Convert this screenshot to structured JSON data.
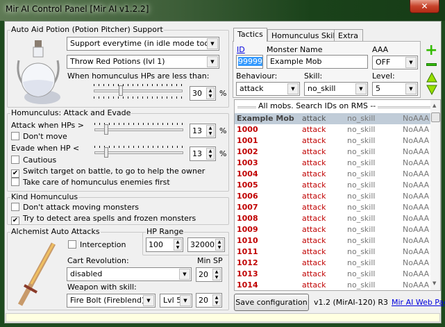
{
  "window": {
    "title": "Mir AI Control Panel [Mir AI v1.2.2]",
    "close": "✕"
  },
  "potion": {
    "group": "Auto Aid Potion (Potion Pitcher) Support",
    "mode": "Support everytime (in idle mode too)",
    "potion": "Throw Red Potions (lvl 1)",
    "hp_label": "When homunculus HPs are less than:",
    "hp_value": "30",
    "hp_percent": 30,
    "unit": "%"
  },
  "attack": {
    "group": "Homunculus: Attack and Evade",
    "attack_label": "Attack when HPs >",
    "attack_value": "13",
    "attack_percent": 13,
    "dont_move": "Don't move",
    "evade_label": "Evade when HP <",
    "evade_value": "13",
    "evade_percent": 13,
    "cautious": "Cautious",
    "switch_target": "Switch target on battle, to go to help the owner",
    "take_care": "Take care of homunculus enemies first",
    "unit": "%"
  },
  "kind": {
    "group": "Kind Homunculus",
    "dont_attack": "Don't attack moving monsters",
    "detect": "Try to detect area spells and frozen monsters"
  },
  "alch": {
    "group": "Alchemist Auto Attacks",
    "interception": "Interception",
    "hp_range": "HP Range",
    "hp_min": "100",
    "hp_max": "32000",
    "cart_label": "Cart Revolution:",
    "cart_value": "disabled",
    "min_sp": "Min SP",
    "cart_sp": "20",
    "weapon_label": "Weapon with skill:",
    "weapon_value": "Fire Bolt (Fireblend)",
    "weapon_lvl": "Lvl 5",
    "weapon_sp": "20"
  },
  "tabs": [
    "Tactics",
    "Homunculus Skills",
    "Extra"
  ],
  "tactics": {
    "id_label": "ID",
    "id_value": "99999",
    "name_label": "Monster Name",
    "name_value": "Example Mob",
    "aaa_label": "AAA",
    "aaa_value": "OFF",
    "behaviour_label": "Behaviour:",
    "behaviour_value": "attack",
    "skill_label": "Skill:",
    "skill_value": "no_skill",
    "level_label": "Level:",
    "level_value": "5"
  },
  "list": {
    "header": "All mobs. Search IDs on RMS --",
    "rows": [
      {
        "name": "Example Mob",
        "behaviour": "attack",
        "skill": "no_skill",
        "aaa": "NoAAA"
      },
      {
        "name": "1000",
        "behaviour": "attack",
        "skill": "no_skill",
        "aaa": "NoAAA"
      },
      {
        "name": "1001",
        "behaviour": "attack",
        "skill": "no_skill",
        "aaa": "NoAAA"
      },
      {
        "name": "1002",
        "behaviour": "attack",
        "skill": "no_skill",
        "aaa": "NoAAA"
      },
      {
        "name": "1003",
        "behaviour": "attack",
        "skill": "no_skill",
        "aaa": "NoAAA"
      },
      {
        "name": "1004",
        "behaviour": "attack",
        "skill": "no_skill",
        "aaa": "NoAAA"
      },
      {
        "name": "1005",
        "behaviour": "attack",
        "skill": "no_skill",
        "aaa": "NoAAA"
      },
      {
        "name": "1006",
        "behaviour": "attack",
        "skill": "no_skill",
        "aaa": "NoAAA"
      },
      {
        "name": "1007",
        "behaviour": "attack",
        "skill": "no_skill",
        "aaa": "NoAAA"
      },
      {
        "name": "1008",
        "behaviour": "attack",
        "skill": "no_skill",
        "aaa": "NoAAA"
      },
      {
        "name": "1009",
        "behaviour": "attack",
        "skill": "no_skill",
        "aaa": "NoAAA"
      },
      {
        "name": "1010",
        "behaviour": "attack",
        "skill": "no_skill",
        "aaa": "NoAAA"
      },
      {
        "name": "1011",
        "behaviour": "attack",
        "skill": "no_skill",
        "aaa": "NoAAA"
      },
      {
        "name": "1012",
        "behaviour": "attack",
        "skill": "no_skill",
        "aaa": "NoAAA"
      },
      {
        "name": "1013",
        "behaviour": "attack",
        "skill": "no_skill",
        "aaa": "NoAAA"
      },
      {
        "name": "1014",
        "behaviour": "attack",
        "skill": "no_skill",
        "aaa": "NoAAA"
      }
    ]
  },
  "footer": {
    "save": "Save configuration",
    "version": "v1.2 (MirAI-120) R3",
    "link": "Mir AI Web Page"
  },
  "colors": {
    "accent_red": "#c00000",
    "selected_row": "#c0ccd8",
    "status_bar": "#ffffe1",
    "icon_green": "#33bb00"
  },
  "icons": {
    "add": "plus-icon",
    "remove": "minus-icon",
    "up": "arrow-up-icon",
    "down": "arrow-down-icon"
  }
}
